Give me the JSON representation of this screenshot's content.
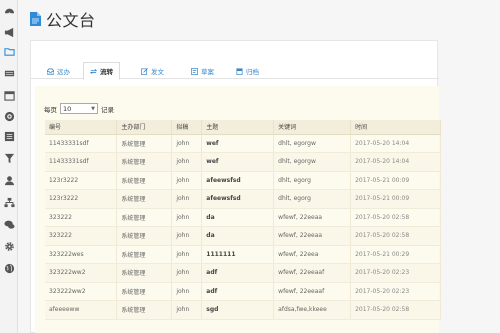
{
  "header": {
    "title": "公文台"
  },
  "sidebar": {
    "icons": [
      "dashboard-icon",
      "megaphone-icon",
      "folder-icon",
      "keyboard-icon",
      "calendar-icon",
      "target-icon",
      "list-icon",
      "filter-icon",
      "user-icon",
      "sitemap-icon",
      "chat-icon",
      "gear-icon",
      "globe-icon"
    ]
  },
  "tabs": [
    {
      "label": "远办",
      "icon": "inbox-icon"
    },
    {
      "label": "流转",
      "icon": "transfer-icon"
    },
    {
      "label": "发文",
      "icon": "edit-icon"
    },
    {
      "label": "草案",
      "icon": "draft-icon"
    },
    {
      "label": "归档",
      "icon": "archive-icon"
    }
  ],
  "pager": {
    "prefix": "每页",
    "value": "10",
    "suffix": "记录"
  },
  "table": {
    "columns": [
      "编号",
      "主办部门",
      "拟稿",
      "主题",
      "关键词",
      "时间"
    ],
    "rows": [
      [
        "11433331sdf",
        "系统管理",
        "john",
        "wef",
        "dhlt, egorgw",
        "2017-05-20 14:04"
      ],
      [
        "11433331sdf",
        "系统管理",
        "john",
        "wef",
        "dhlt, egorgw",
        "2017-05-20 14:04"
      ],
      [
        "123r3222",
        "系统管理",
        "john",
        "afeewsfsd",
        "dhlt, egorg",
        "2017-05-21 00:09"
      ],
      [
        "123r3222",
        "系统管理",
        "john",
        "afeewsfsd",
        "dhlt, egorg",
        "2017-05-21 00:09"
      ],
      [
        "323222",
        "系统管理",
        "john",
        "da",
        "wfewf, 22eeaa",
        "2017-05-20 02:58"
      ],
      [
        "323222",
        "系统管理",
        "john",
        "da",
        "wfewf, 22eeaa",
        "2017-05-20 02:58"
      ],
      [
        "323222wes",
        "系统管理",
        "john",
        "1111111",
        "wfewf, 22eea",
        "2017-05-21 00:29"
      ],
      [
        "323222ww2",
        "系统管理",
        "john",
        "adf",
        "wfewf, 22eeaaf",
        "2017-05-20 02:23"
      ],
      [
        "323222ww2",
        "系统管理",
        "john",
        "adf",
        "wfewf, 22eeaaf",
        "2017-05-20 02:23"
      ],
      [
        "afeeeeww",
        "系统管理",
        "john",
        "sgd",
        "afdsa,fwe,kkeee",
        "2017-05-20 02:58"
      ]
    ]
  },
  "colors": {
    "accent": "#2d8bd9",
    "panel_bg": "#fdfaee",
    "header_bg": "#f3eedc"
  }
}
